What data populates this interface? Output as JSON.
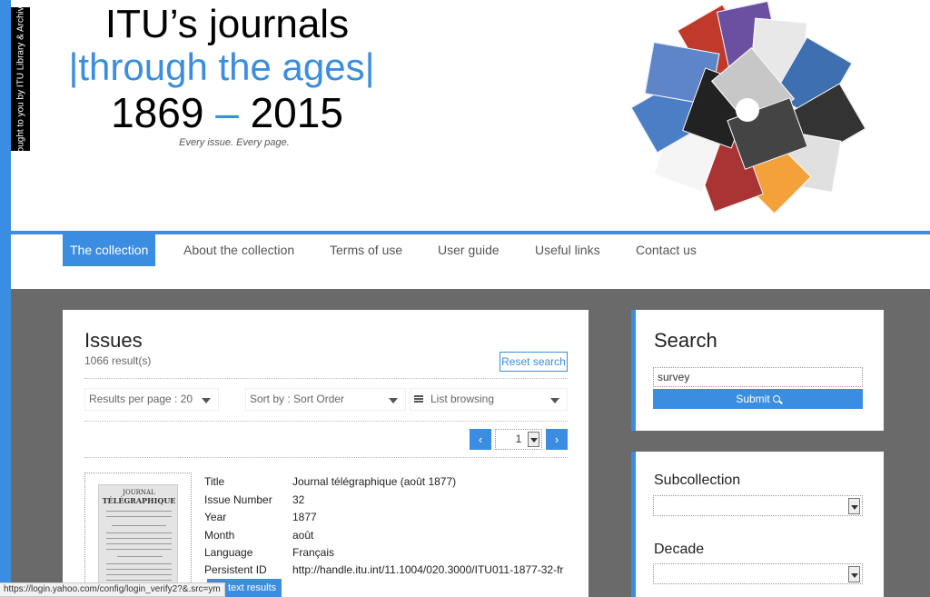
{
  "header": {
    "brought_by": "Brought to you by ITU Library & Archives",
    "title_line1": "ITU’s journals",
    "title_line2": "|through the ages|",
    "year_start": "1869",
    "year_dash": "–",
    "year_end": "2015",
    "tagline": "Every issue. Every page."
  },
  "nav": {
    "items": [
      {
        "label": "The collection",
        "active": true
      },
      {
        "label": "About the collection",
        "active": false
      },
      {
        "label": "Terms of use",
        "active": false
      },
      {
        "label": "User guide",
        "active": false
      },
      {
        "label": "Useful links",
        "active": false
      },
      {
        "label": "Contact us",
        "active": false
      }
    ]
  },
  "issues": {
    "title": "Issues",
    "result_count": "1066 result(s)",
    "reset_label": "Reset search",
    "results_per_page": "Results per page : 20",
    "sort_by": "Sort by : Sort Order",
    "view_mode": "List browsing",
    "pagination": {
      "prev": "‹",
      "page": "1",
      "next": "›"
    },
    "thumbnail": {
      "line1": "JOURNAL",
      "line2": "TÉLÉGRAPHIQUE"
    },
    "record": [
      {
        "label": "Title",
        "value": "Journal télégraphique (août 1877)"
      },
      {
        "label": "Issue Number",
        "value": "32"
      },
      {
        "label": "Year",
        "value": "1877"
      },
      {
        "label": "Month",
        "value": "août"
      },
      {
        "label": "Language",
        "value": "Français"
      },
      {
        "label": "Persistent ID",
        "value": "http://handle.itu.int/11.1004/020.3000/ITU011-1877-32-fr"
      }
    ],
    "full_text_label": "full text results"
  },
  "search": {
    "title": "Search",
    "query": "survey",
    "submit_label": "Submit"
  },
  "filters": {
    "subcollection_label": "Subcollection",
    "subcollection_value": "",
    "decade_label": "Decade",
    "decade_value": ""
  },
  "status_bar": {
    "url": "https://login.yahoo.com/config/login_verify2?&.src=ym"
  },
  "colors": {
    "accent": "#3a8de0",
    "gray_background": "#6a6a6a"
  }
}
